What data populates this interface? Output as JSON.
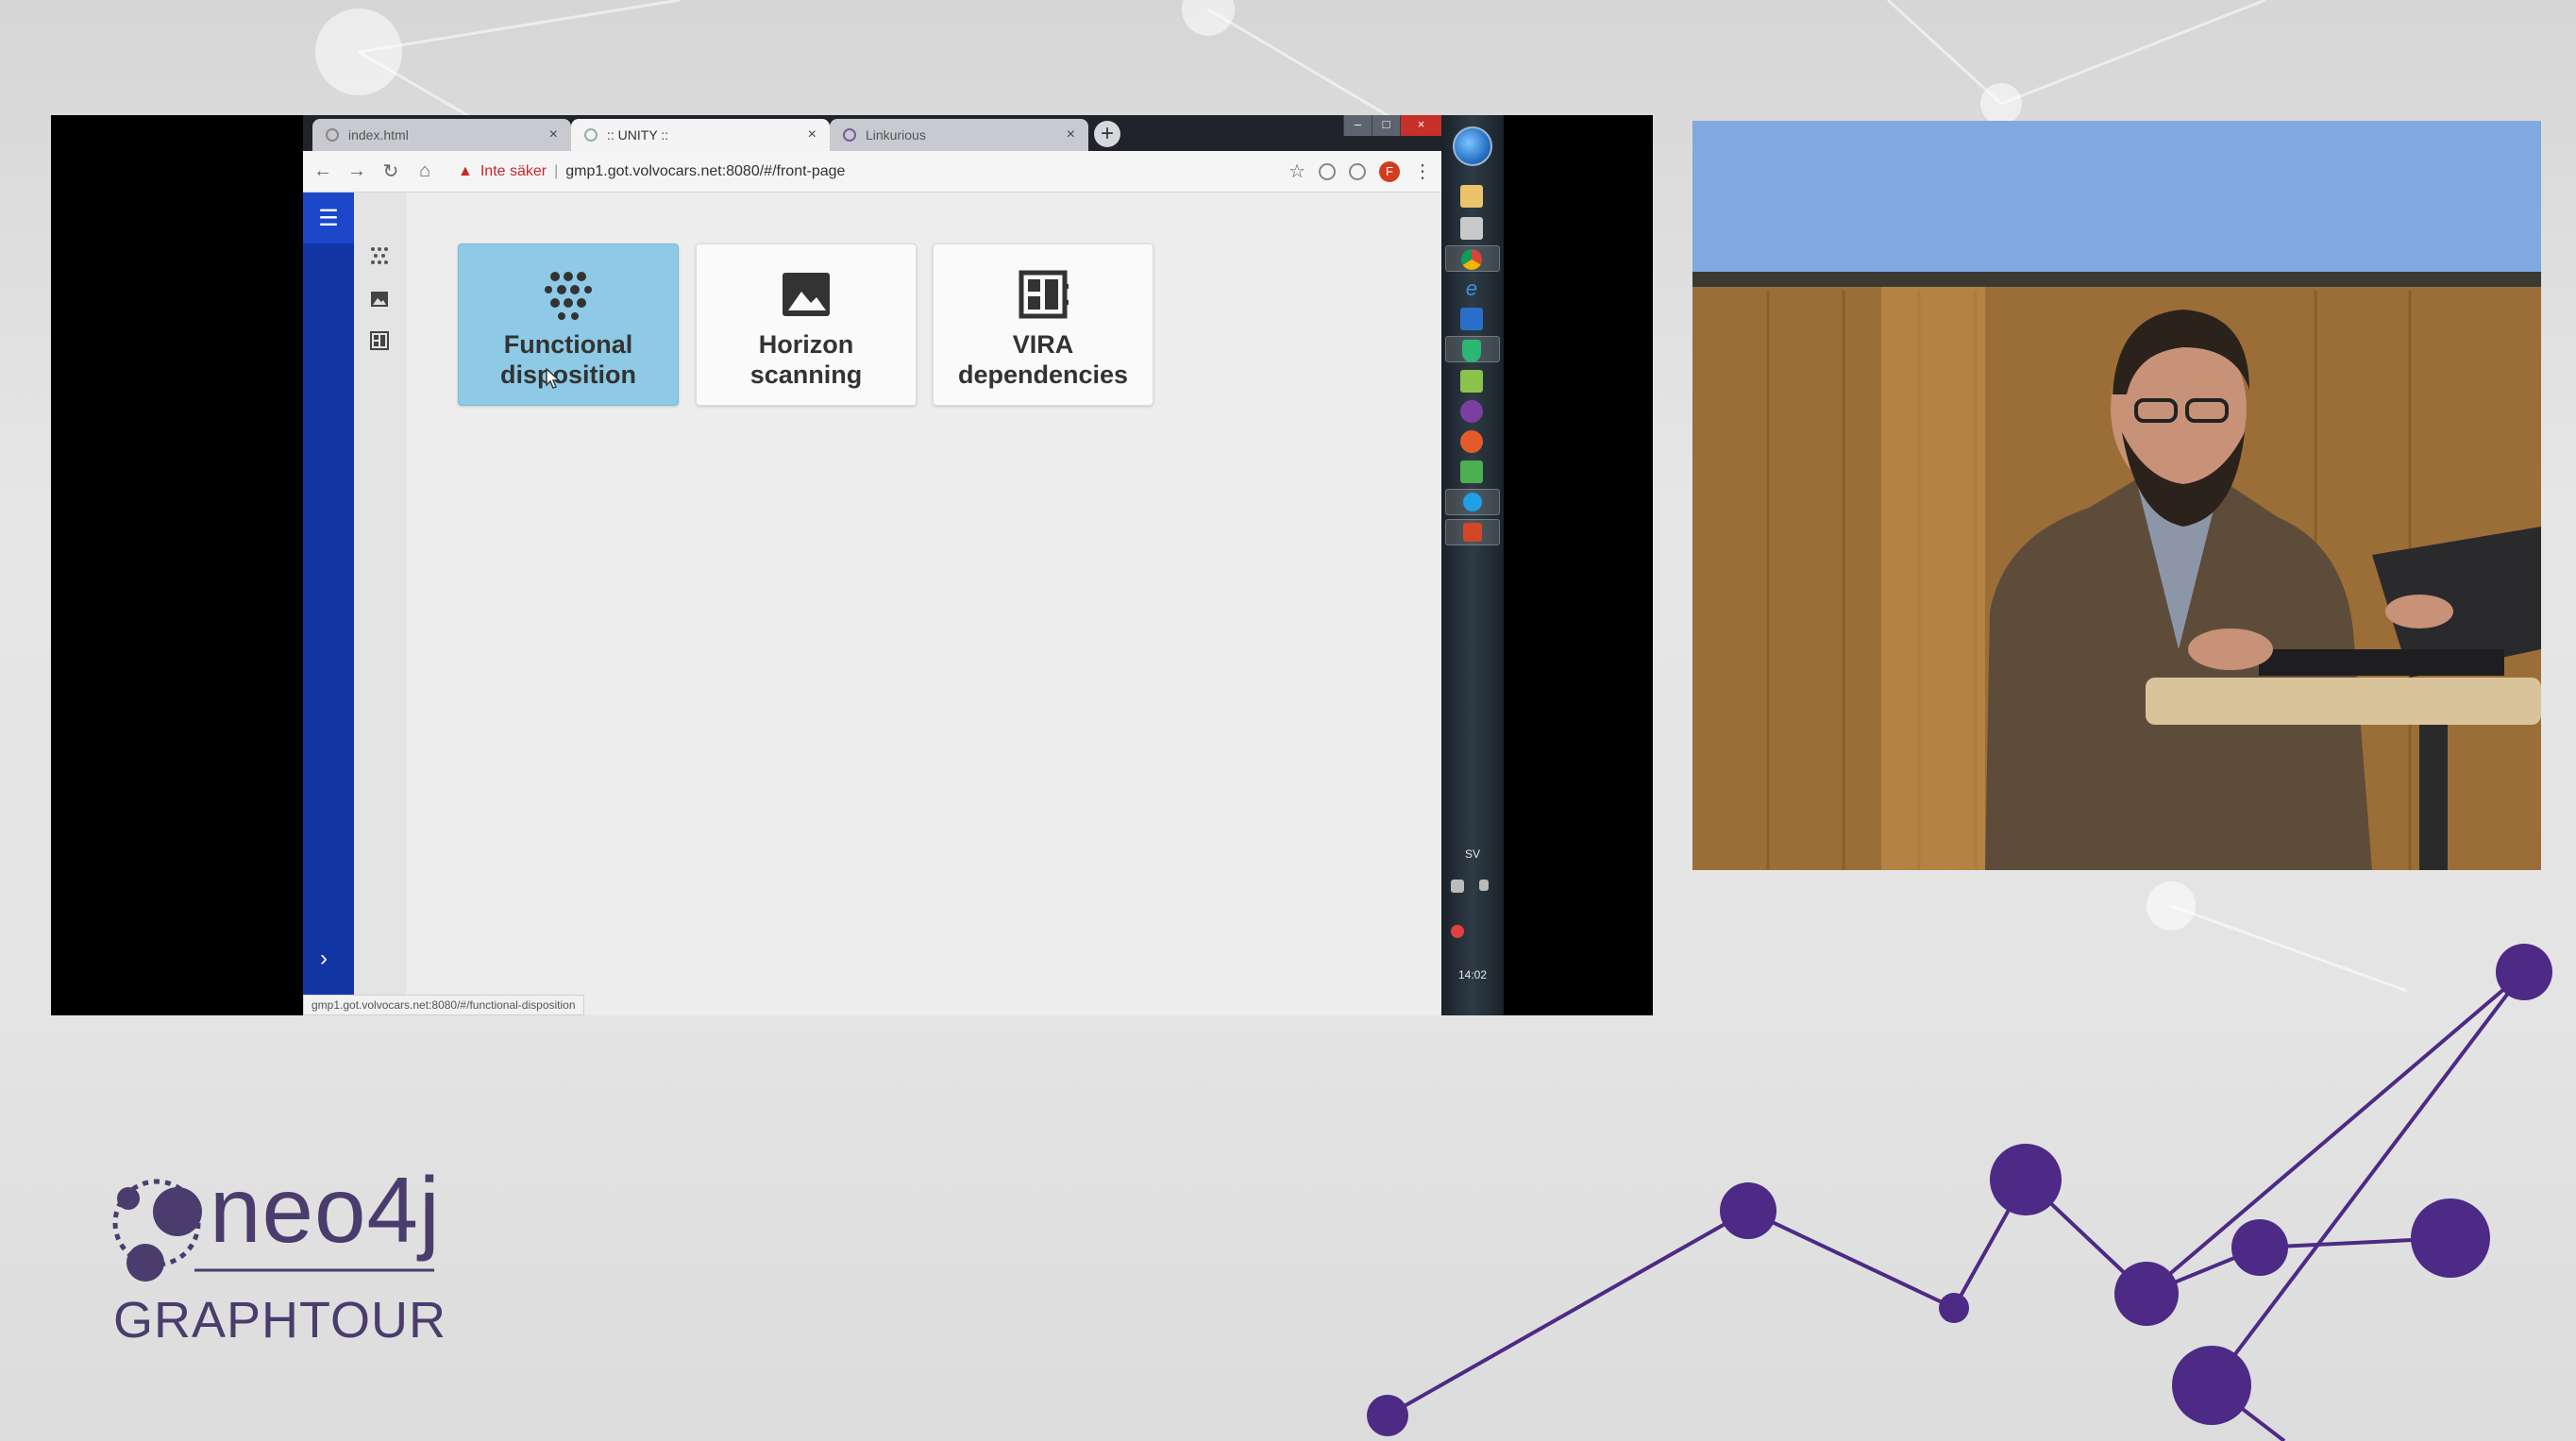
{
  "browser": {
    "tabs": [
      {
        "label": "index.html",
        "close": "×"
      },
      {
        "label": ":: UNITY ::",
        "close": "×"
      },
      {
        "label": "Linkurious",
        "close": "×"
      }
    ],
    "new_tab": "+",
    "window_controls": {
      "minimize": "–",
      "maximize": "□",
      "close": "×"
    },
    "security_warning": "Inte säker",
    "url": "gmp1.got.volvocars.net:8080/#/front-page",
    "profile_initial": "F",
    "status_url": "gmp1.got.volvocars.net:8080/#/functional-disposition"
  },
  "app": {
    "cards": [
      {
        "title": "Functional disposition",
        "icon": "dots-grid-icon",
        "active": true
      },
      {
        "title": "Horizon scanning",
        "icon": "image-icon",
        "active": false
      },
      {
        "title": "VIRA dependencies",
        "icon": "dashboard-icon",
        "active": false
      }
    ],
    "colors": {
      "sidebar": "#1235a6",
      "active_card": "#8ecae6"
    }
  },
  "taskbar": {
    "lang": "SV",
    "clock": "14:02"
  },
  "branding": {
    "logo_word": "neo4j",
    "event": "GRAPHTOUR",
    "accent": "#5a2d8c"
  }
}
